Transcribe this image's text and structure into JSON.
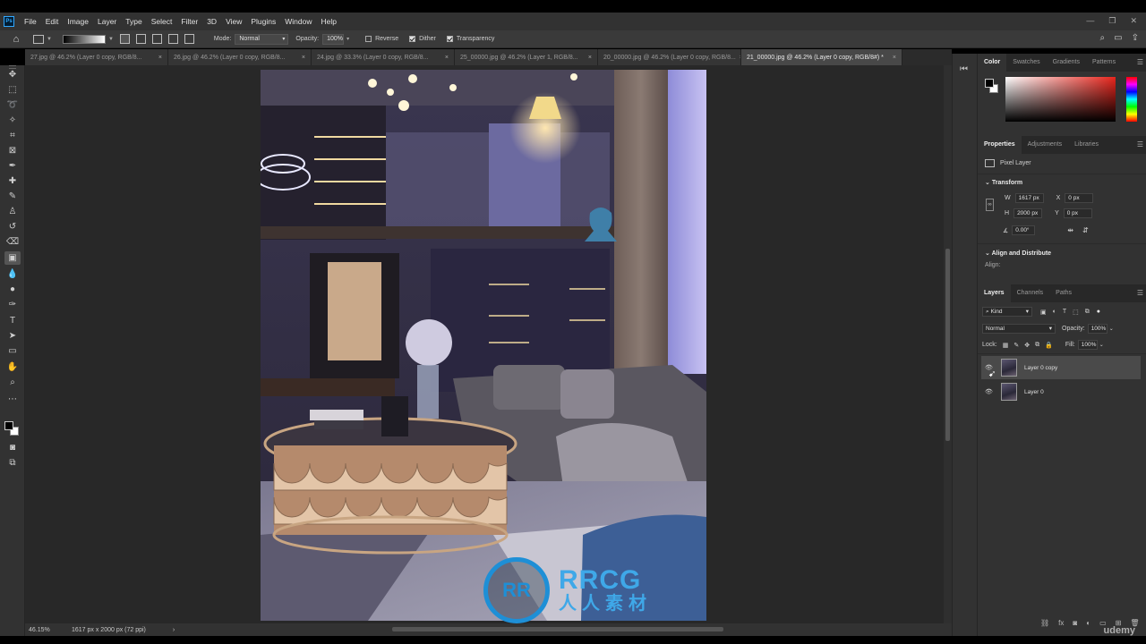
{
  "menubar": {
    "items": [
      "File",
      "Edit",
      "Image",
      "Layer",
      "Type",
      "Select",
      "Filter",
      "3D",
      "View",
      "Plugins",
      "Window",
      "Help"
    ],
    "app_icon": "Ps"
  },
  "options": {
    "mode_label": "Mode:",
    "mode_value": "Normal",
    "opacity_label": "Opacity:",
    "opacity_value": "100%",
    "reverse_label": "Reverse",
    "dither_label": "Dither",
    "transparency_label": "Transparency"
  },
  "tabs": [
    {
      "label": "27.jpg @ 46.2% (Layer 0 copy, RGB/8...",
      "close": "×"
    },
    {
      "label": "26.jpg @ 46.2% (Layer 0 copy, RGB/8...",
      "close": "×"
    },
    {
      "label": "24.jpg @ 33.3% (Layer 0 copy, RGB/8...",
      "close": "×"
    },
    {
      "label": "25_00000.jpg @ 46.2% (Layer 1, RGB/8...",
      "close": "×"
    },
    {
      "label": "20_00000.jpg @ 46.2% (Layer 0 copy, RGB/8...",
      "close": "×"
    },
    {
      "label": "21_00000.jpg @ 46.2% (Layer 0 copy, RGB/8#) *",
      "close": "×"
    }
  ],
  "status": {
    "zoom": "46.15%",
    "dimensions": "1617 px x 2000 px (72 ppi)",
    "arrow": "›"
  },
  "watermark": {
    "logo_text": "RR",
    "brand": "RRCG",
    "chinese": "人人素材"
  },
  "udemy": "udemy",
  "color_panel": {
    "tabs": [
      "Color",
      "Swatches",
      "Gradients",
      "Patterns"
    ]
  },
  "properties": {
    "tabs": [
      "Properties",
      "Adjustments",
      "Libraries"
    ],
    "kind": "Pixel Layer",
    "transform_title": "Transform",
    "w_label": "W",
    "w_value": "1617 px",
    "h_label": "H",
    "h_value": "2000 px",
    "x_label": "X",
    "x_value": "0 px",
    "y_label": "Y",
    "y_value": "0 px",
    "angle_value": "0.00°",
    "align_title": "Align and Distribute",
    "align_label": "Align:"
  },
  "layers": {
    "tabs": [
      "Layers",
      "Channels",
      "Paths"
    ],
    "filter_label": "Kind",
    "blend_mode": "Normal",
    "opacity_label": "Opacity:",
    "opacity_value": "100%",
    "lock_label": "Lock:",
    "fill_label": "Fill:",
    "fill_value": "100%",
    "items": [
      {
        "name": "Layer 0 copy",
        "selected": true
      },
      {
        "name": "Layer 0",
        "selected": false
      }
    ]
  },
  "colors": {
    "panel_bg": "#323232",
    "canvas_bg": "#282828",
    "accent": "#31a8ff",
    "watermark_blue": "#1e8fd6"
  }
}
